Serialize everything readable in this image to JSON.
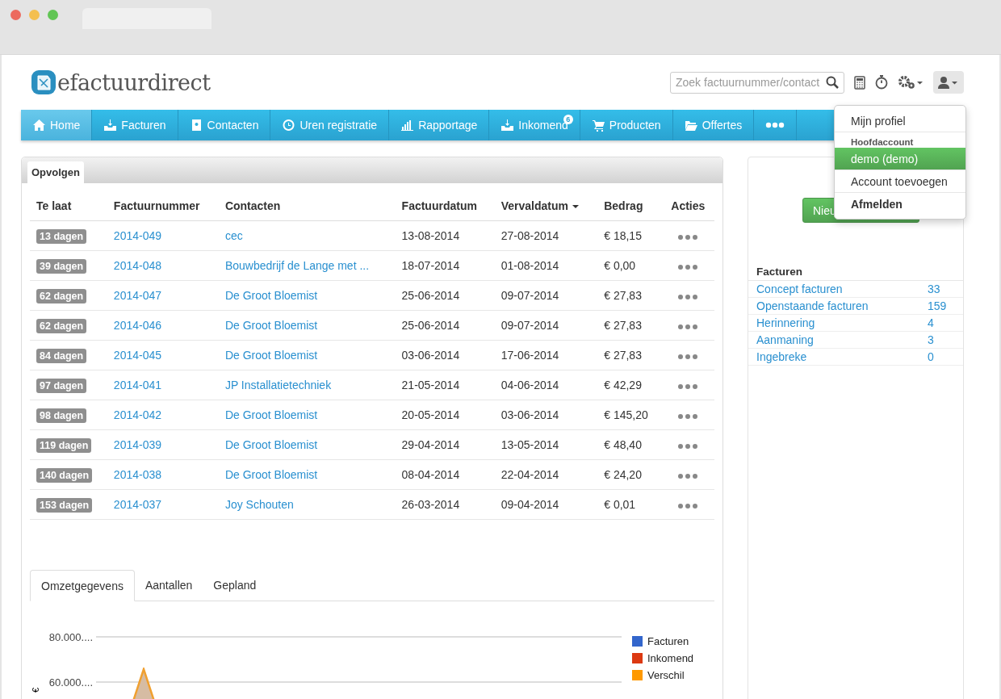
{
  "logo": {
    "light": "efactuur",
    "tail": "direct"
  },
  "search": {
    "placeholder": "Zoek factuurnummer/contact"
  },
  "nav": [
    {
      "kind": "link",
      "label": "Home",
      "selected": true
    },
    {
      "kind": "link",
      "label": "Facturen",
      "selected": false
    },
    {
      "kind": "link",
      "label": "Contacten",
      "selected": false
    },
    {
      "kind": "link",
      "label": "Uren registratie",
      "selected": false
    },
    {
      "kind": "link",
      "label": "Rapportage",
      "selected": false
    },
    {
      "kind": "link",
      "label": "Inkomend",
      "selected": false,
      "badge": "6"
    },
    {
      "kind": "link",
      "label": "Producten",
      "selected": false
    },
    {
      "kind": "link",
      "label": "Offertes",
      "selected": false
    },
    {
      "kind": "more",
      "selected": false
    }
  ],
  "user_menu": [
    {
      "kind": "item",
      "label": "Mijn profiel",
      "selected": false
    },
    {
      "kind": "header",
      "label": "Hoofdaccount"
    },
    {
      "kind": "item",
      "label": "demo (demo)",
      "selected": true
    },
    {
      "kind": "item",
      "label": "Account toevoegen",
      "selected": false
    },
    {
      "kind": "strong",
      "label": "Afmelden",
      "selected": false
    }
  ],
  "panel": {
    "tab": "Opvolgen",
    "columns": [
      {
        "label": "Te laat",
        "sorted": false
      },
      {
        "label": "Factuurnummer",
        "sorted": false
      },
      {
        "label": "Contacten",
        "sorted": false
      },
      {
        "label": "Factuurdatum",
        "sorted": false
      },
      {
        "label": "Vervaldatum",
        "sorted": true
      },
      {
        "label": "Bedrag",
        "sorted": false
      },
      {
        "label": "Acties",
        "sorted": false
      }
    ],
    "rows": [
      {
        "late": "13 dagen",
        "number": "2014-049",
        "contact": "cec",
        "date": "13-08-2014",
        "due": "27-08-2014",
        "amount": "€ 18,15"
      },
      {
        "late": "39 dagen",
        "number": "2014-048",
        "contact": "Bouwbedrijf de Lange met ...",
        "date": "18-07-2014",
        "due": "01-08-2014",
        "amount": "€ 0,00"
      },
      {
        "late": "62 dagen",
        "number": "2014-047",
        "contact": "De Groot Bloemist",
        "date": "25-06-2014",
        "due": "09-07-2014",
        "amount": "€ 27,83"
      },
      {
        "late": "62 dagen",
        "number": "2014-046",
        "contact": "De Groot Bloemist",
        "date": "25-06-2014",
        "due": "09-07-2014",
        "amount": "€ 27,83"
      },
      {
        "late": "84 dagen",
        "number": "2014-045",
        "contact": "De Groot Bloemist",
        "date": "03-06-2014",
        "due": "17-06-2014",
        "amount": "€ 27,83"
      },
      {
        "late": "97 dagen",
        "number": "2014-041",
        "contact": "JP Installatietechniek",
        "date": "21-05-2014",
        "due": "04-06-2014",
        "amount": "€ 42,29"
      },
      {
        "late": "98 dagen",
        "number": "2014-042",
        "contact": "De Groot Bloemist",
        "date": "20-05-2014",
        "due": "03-06-2014",
        "amount": "€ 145,20"
      },
      {
        "late": "119 dagen",
        "number": "2014-039",
        "contact": "De Groot Bloemist",
        "date": "29-04-2014",
        "due": "13-05-2014",
        "amount": "€ 48,40"
      },
      {
        "late": "140 dagen",
        "number": "2014-038",
        "contact": "De Groot Bloemist",
        "date": "08-04-2014",
        "due": "22-04-2014",
        "amount": "€ 24,20"
      },
      {
        "late": "153 dagen",
        "number": "2014-037",
        "contact": "Joy Schouten",
        "date": "26-03-2014",
        "due": "09-04-2014",
        "amount": "€ 0,01"
      }
    ]
  },
  "chart_tabs": [
    {
      "label": "Omzetgegevens",
      "selected": true
    },
    {
      "label": "Aantallen",
      "selected": false
    },
    {
      "label": "Gepland",
      "selected": false
    }
  ],
  "chart": {
    "yticks": [
      "80.000....",
      "60.000...."
    ],
    "ylabel": "€",
    "legend": [
      {
        "name": "Facturen",
        "color": "#3366cc"
      },
      {
        "name": "Inkomend",
        "color": "#dc3912"
      },
      {
        "name": "Verschil",
        "color": "#ff9900"
      }
    ]
  },
  "sidebar": {
    "button": "Nieu",
    "title": "Facturen",
    "items": [
      {
        "label": "Concept facturen",
        "count": "33"
      },
      {
        "label": "Openstaande facturen",
        "count": "159"
      },
      {
        "label": "Herinnering",
        "count": "4"
      },
      {
        "label": "Aanmaning",
        "count": "3"
      },
      {
        "label": "Ingebreke",
        "count": "0"
      }
    ]
  }
}
